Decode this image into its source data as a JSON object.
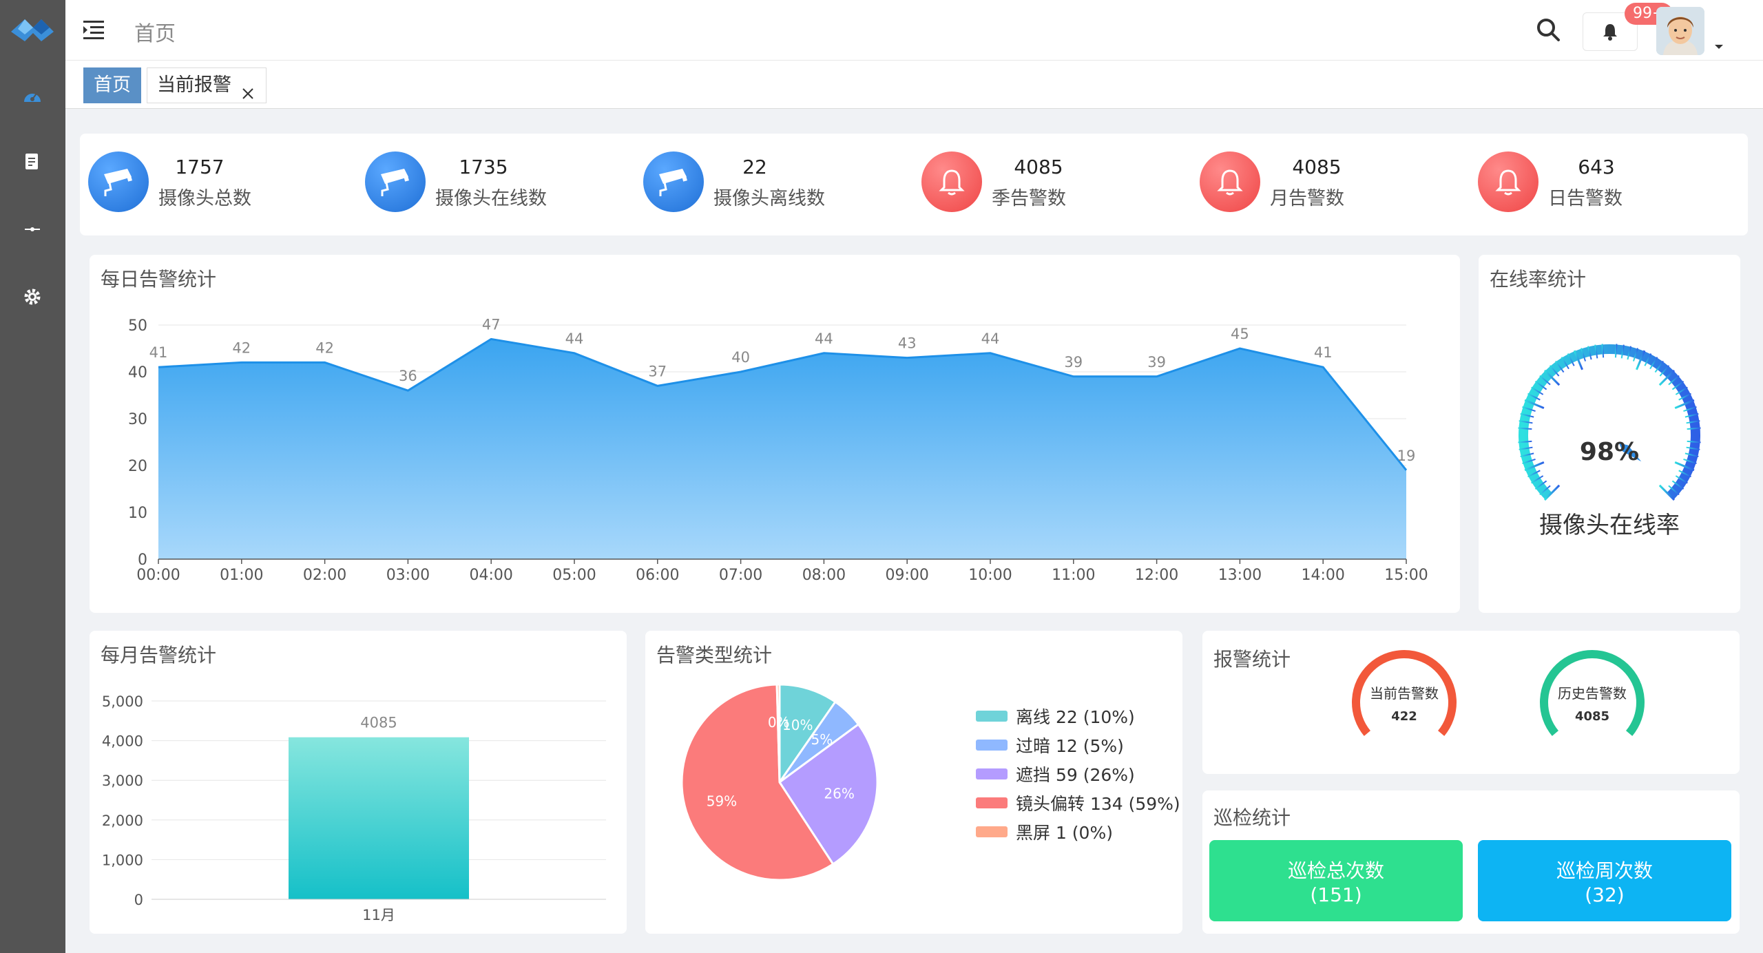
{
  "sidebar": {
    "icons": [
      "logo-icon",
      "dashboard-icon",
      "document-icon",
      "connection-icon",
      "settings-icon"
    ]
  },
  "header": {
    "breadcrumb": "首页",
    "badge": "99+"
  },
  "tabs": [
    {
      "label": "首页",
      "active": true
    },
    {
      "label": "当前报警",
      "closable": true
    }
  ],
  "stats": [
    {
      "value": "1757",
      "label": "摄像头总数",
      "color": "#2f82e6",
      "icon": "camera-icon"
    },
    {
      "value": "1735",
      "label": "摄像头在线数",
      "color": "#2f82e6",
      "icon": "camera-icon"
    },
    {
      "value": "22",
      "label": "摄像头离线数",
      "color": "#2f82e6",
      "icon": "camera-icon"
    },
    {
      "value": "4085",
      "label": "季告警数",
      "color": "#f35353",
      "icon": "bell-icon"
    },
    {
      "value": "4085",
      "label": "月告警数",
      "color": "#f35353",
      "icon": "bell-icon"
    },
    {
      "value": "643",
      "label": "日告警数",
      "color": "#f35353",
      "icon": "bell-icon"
    }
  ],
  "daily": {
    "title": "每日告警统计",
    "chart_data": {
      "type": "area",
      "categories": [
        "00:00",
        "01:00",
        "02:00",
        "03:00",
        "04:00",
        "05:00",
        "06:00",
        "07:00",
        "08:00",
        "09:00",
        "10:00",
        "11:00",
        "12:00",
        "13:00",
        "14:00",
        "15:00"
      ],
      "values": [
        41,
        42,
        42,
        36,
        47,
        44,
        37,
        40,
        44,
        43,
        44,
        39,
        39,
        45,
        41,
        19
      ],
      "ylim": [
        0,
        50
      ],
      "yticks": [
        0,
        10,
        20,
        30,
        40,
        50
      ],
      "grid": true,
      "color": "#1e90e8"
    }
  },
  "online": {
    "title": "在线率统计",
    "value": 98,
    "value_text": "98%",
    "caption": "摄像头在线率"
  },
  "monthly": {
    "title": "每月告警统计",
    "chart_data": {
      "type": "bar",
      "categories": [
        "11月"
      ],
      "values": [
        4085
      ],
      "ylim": [
        0,
        5000
      ],
      "yticks": [
        "0",
        "1,000",
        "2,000",
        "3,000",
        "4,000",
        "5,000"
      ],
      "data_labels": [
        "4085"
      ]
    }
  },
  "types": {
    "title": "告警类型统计",
    "chart_data": {
      "type": "pie",
      "slices": [
        {
          "name": "离线",
          "value": 22,
          "pct": "10%",
          "legend": "离线 22 (10%)",
          "color": "#6fd3d9"
        },
        {
          "name": "过暗",
          "value": 12,
          "pct": "5%",
          "legend": "过暗 12 (5%)",
          "color": "#8fb8ff"
        },
        {
          "name": "遮挡",
          "value": 59,
          "pct": "26%",
          "legend": "遮挡 59 (26%)",
          "color": "#b49cff"
        },
        {
          "name": "镜头偏转",
          "value": 134,
          "pct": "59%",
          "legend": "镜头偏转 134 (59%)",
          "color": "#fb7b7b"
        },
        {
          "name": "黑屏",
          "value": 1,
          "pct": "0%",
          "legend": "黑屏 1 (0%)",
          "color": "#ffa98a"
        }
      ]
    }
  },
  "alarm_stats": {
    "title": "报警统计",
    "current": {
      "label": "当前告警数",
      "value": "422",
      "color": "#f2583a"
    },
    "history": {
      "label": "历史告警数",
      "value": "4085",
      "color": "#24c593"
    }
  },
  "patrol": {
    "title": "巡检统计",
    "total": {
      "label": "巡检总次数",
      "count": "(151)"
    },
    "week": {
      "label": "巡检周次数",
      "count": "(32)"
    }
  }
}
